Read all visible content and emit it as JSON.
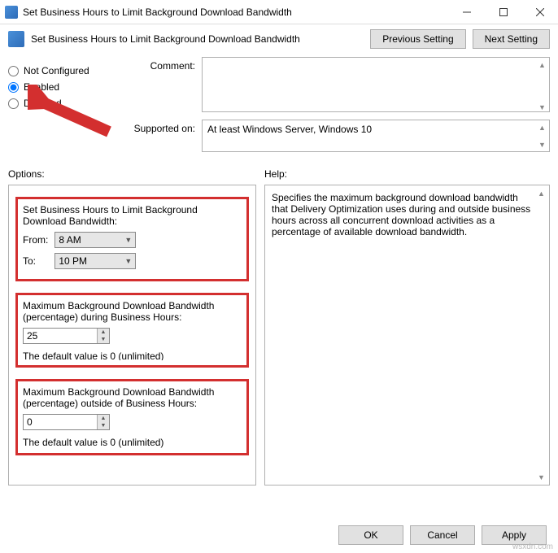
{
  "window": {
    "title": "Set Business Hours to Limit Background Download Bandwidth"
  },
  "header": {
    "title": "Set Business Hours to Limit Background Download Bandwidth",
    "prev": "Previous Setting",
    "next": "Next Setting"
  },
  "radios": {
    "not_configured": "Not Configured",
    "enabled": "Enabled",
    "disabled": "Disabled"
  },
  "labels": {
    "comment": "Comment:",
    "supported": "Supported on:",
    "options": "Options:",
    "help": "Help:"
  },
  "supported_text": "At least Windows Server, Windows 10",
  "options": {
    "box1_title": "Set Business Hours to Limit Background Download Bandwidth:",
    "from_label": "From:",
    "from_value": "8 AM",
    "to_label": "To:",
    "to_value": "10 PM",
    "box2_title": "Maximum Background Download Bandwidth (percentage) during Business Hours:",
    "box2_value": "25",
    "box2_note_cut": "The default value is 0 (unlimited)",
    "box3_title": "Maximum Background Download Bandwidth (percentage) outside of Business Hours:",
    "box3_value": "0",
    "box3_note": "The default value is 0 (unlimited)"
  },
  "help_text": "Specifies the maximum background download bandwidth that Delivery Optimization uses during and outside business hours across all concurrent download activities as a percentage of available download bandwidth.",
  "footer": {
    "ok": "OK",
    "cancel": "Cancel",
    "apply": "Apply"
  },
  "watermark": "wsxdn.com"
}
